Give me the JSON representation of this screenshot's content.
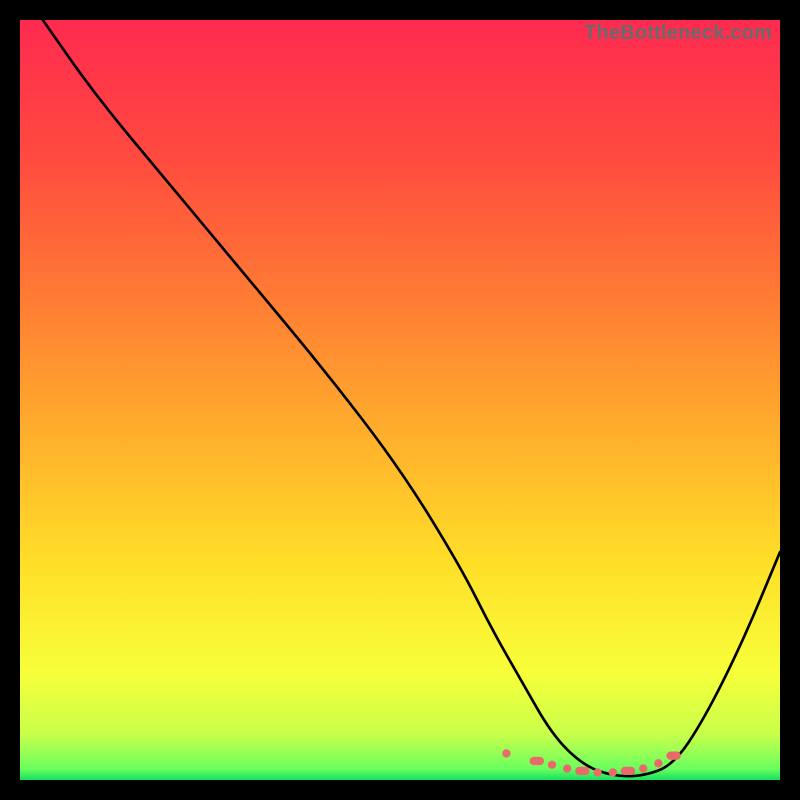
{
  "watermark": "TheBottleneck.com",
  "chart_data": {
    "type": "line",
    "title": "",
    "xlabel": "",
    "ylabel": "",
    "xlim": [
      0,
      100
    ],
    "ylim": [
      0,
      100
    ],
    "grid": false,
    "legend": false,
    "series": [
      {
        "name": "bottleneck-curve",
        "x": [
          3,
          10,
          20,
          30,
          40,
          50,
          58,
          62,
          66,
          70,
          74,
          78,
          82,
          86,
          90,
          95,
          100
        ],
        "y": [
          100,
          90,
          78,
          66,
          54,
          41,
          28,
          20,
          13,
          6,
          2,
          0.5,
          0.5,
          2,
          8,
          18,
          30
        ]
      }
    ],
    "highlight_points": {
      "name": "bottom-cluster",
      "x": [
        64,
        68,
        70,
        72,
        74,
        76,
        78,
        80,
        82,
        84,
        86
      ],
      "y": [
        3.5,
        2.5,
        2,
        1.5,
        1.2,
        1.0,
        1.0,
        1.2,
        1.5,
        2.2,
        3.2
      ]
    },
    "gradient_stops": [
      {
        "offset": 0.0,
        "color": "#ff2a50"
      },
      {
        "offset": 0.18,
        "color": "#ff4a3f"
      },
      {
        "offset": 0.36,
        "color": "#ff7a34"
      },
      {
        "offset": 0.55,
        "color": "#ffb02c"
      },
      {
        "offset": 0.72,
        "color": "#ffe028"
      },
      {
        "offset": 0.86,
        "color": "#f7ff3a"
      },
      {
        "offset": 0.94,
        "color": "#c8ff4a"
      },
      {
        "offset": 0.985,
        "color": "#6bff5e"
      },
      {
        "offset": 1.0,
        "color": "#18e060"
      }
    ],
    "curve_stroke": "#000000",
    "highlight_color": "#e96a6a"
  }
}
